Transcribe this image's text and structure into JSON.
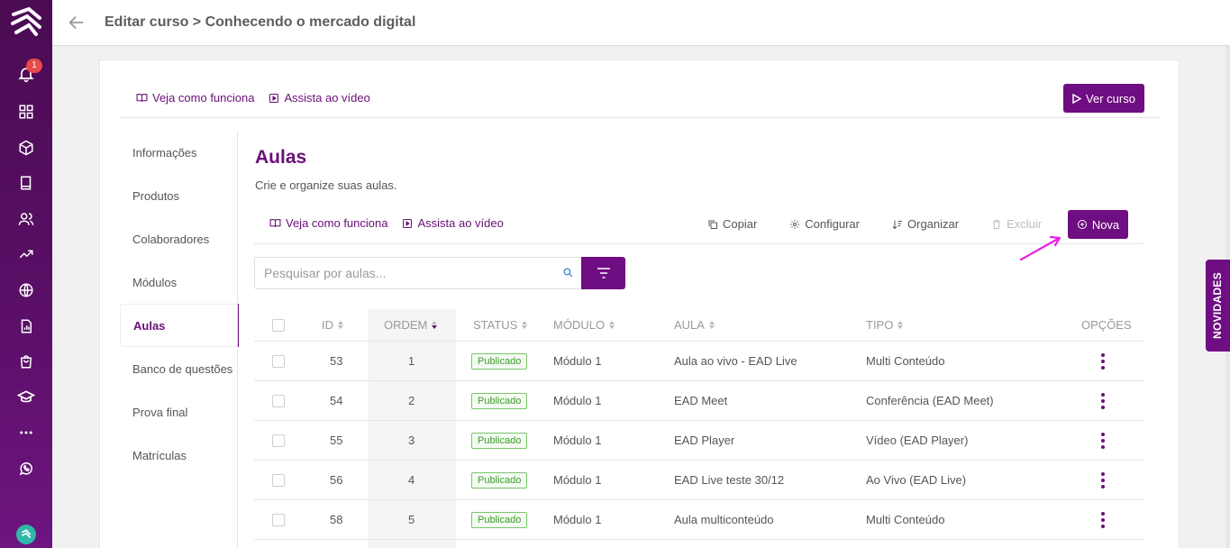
{
  "header": {
    "title": "Editar curso > Conhecendo o mercado digital"
  },
  "rail": {
    "notification_count": "1"
  },
  "top_links": {
    "how_it_works": "Veja como funciona",
    "watch_video": "Assista ao vídeo",
    "view_course": "Ver curso"
  },
  "sidenav": {
    "items": [
      {
        "label": "Informações"
      },
      {
        "label": "Produtos"
      },
      {
        "label": "Colaboradores"
      },
      {
        "label": "Módulos"
      },
      {
        "label": "Aulas"
      },
      {
        "label": "Banco de questões"
      },
      {
        "label": "Prova final"
      },
      {
        "label": "Matrículas"
      }
    ],
    "active": "Aulas"
  },
  "main": {
    "title": "Aulas",
    "subtitle": "Crie e organize suas aulas.",
    "how_it_works": "Veja como funciona",
    "watch_video": "Assista ao vídeo",
    "tools": {
      "copy": "Copiar",
      "configure": "Configurar",
      "organize": "Organizar",
      "delete": "Excluir"
    },
    "new_button": "Nova",
    "search_placeholder": "Pesquisar por aulas..."
  },
  "table": {
    "headers": {
      "id": "ID",
      "order": "ORDEM",
      "status": "STATUS",
      "module": "MÓDULO",
      "lesson": "AULA",
      "type": "TIPO",
      "options": "OPÇÕES"
    },
    "rows": [
      {
        "id": "53",
        "order": "1",
        "status": "Publicado",
        "module": "Módulo 1",
        "lesson": "Aula ao vivo - EAD Live",
        "type": "Multi Conteúdo"
      },
      {
        "id": "54",
        "order": "2",
        "status": "Publicado",
        "module": "Módulo 1",
        "lesson": "EAD Meet",
        "type": "Conferência (EAD Meet)"
      },
      {
        "id": "55",
        "order": "3",
        "status": "Publicado",
        "module": "Módulo 1",
        "lesson": "EAD Player",
        "type": "Vídeo (EAD Player)"
      },
      {
        "id": "56",
        "order": "4",
        "status": "Publicado",
        "module": "Módulo 1",
        "lesson": "EAD Live teste 30/12",
        "type": "Ao Vivo (EAD Live)"
      },
      {
        "id": "58",
        "order": "5",
        "status": "Publicado",
        "module": "Módulo 1",
        "lesson": "Aula multiconteúdo",
        "type": "Multi Conteúdo"
      }
    ]
  },
  "novidades": "NOVIDADES",
  "colors": {
    "brand": "#6f0d82",
    "rail": "#4b0b53",
    "published": "#3c9a2a",
    "arrow": "#e61ee6"
  }
}
